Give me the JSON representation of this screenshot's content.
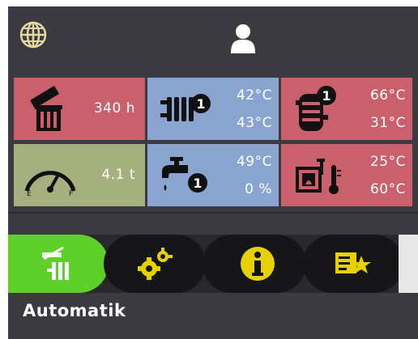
{
  "header": {
    "globe_icon": "globe-icon",
    "user_icon": "user-icon"
  },
  "tiles": [
    {
      "id": "ash",
      "icon": "ash-bin-icon",
      "color": "#c9606b",
      "value": "340 h"
    },
    {
      "id": "heating-circuit-1",
      "icon": "radiator-circuit-1-icon",
      "color": "#8aa4d0",
      "value_top": "42°C",
      "value_bottom": "43°C"
    },
    {
      "id": "buffer-tank-1",
      "icon": "buffer-tank-1-icon",
      "color": "#c9606b",
      "value_top": "66°C",
      "value_bottom": "31°C"
    },
    {
      "id": "fuel-gauge",
      "icon": "fuel-gauge-icon",
      "color": "#a5b07e",
      "value": "4.1 t",
      "gauge_e": "E",
      "gauge_f": "F"
    },
    {
      "id": "hot-water-1",
      "icon": "tap-water-1-icon",
      "color": "#8aa4d0",
      "value_top": "49°C",
      "value_bottom": "0 %"
    },
    {
      "id": "boiler",
      "icon": "boiler-thermometer-icon",
      "color": "#c9606b",
      "value_top": "25°C",
      "value_bottom": "60°C"
    }
  ],
  "badge_number": "1",
  "nav": [
    {
      "id": "auto",
      "icon": "automatic-mode-icon",
      "active": true
    },
    {
      "id": "settings",
      "icon": "gears-icon",
      "active": false
    },
    {
      "id": "info",
      "icon": "info-icon",
      "active": false
    },
    {
      "id": "favorites",
      "icon": "favorites-list-icon",
      "active": false
    }
  ],
  "status": {
    "mode_label": "Automatik"
  },
  "colors": {
    "screen_bg": "#3a3a40",
    "active_green": "#5fcf2a",
    "icon_yellow": "#e6d000"
  }
}
